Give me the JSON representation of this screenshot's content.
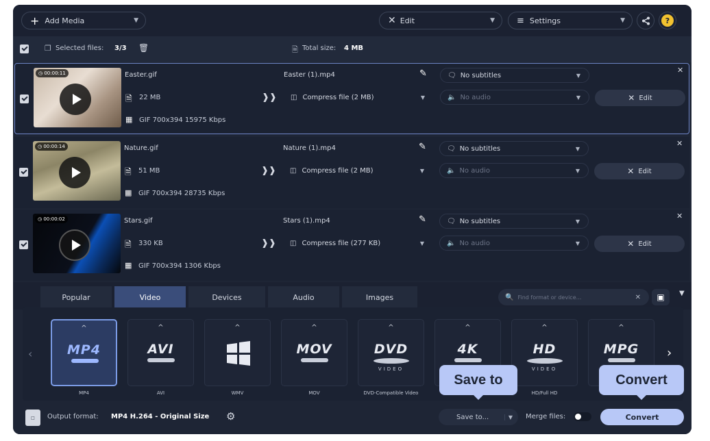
{
  "toolbar": {
    "add_media": "Add Media",
    "edit": "Edit",
    "settings": "Settings"
  },
  "selection": {
    "selected_label": "Selected files:",
    "selected_value": "3/3",
    "total_label": "Total size:",
    "total_value": "4 MB"
  },
  "files": [
    {
      "duration": "00:00:11",
      "name": "Easter.gif",
      "size": "22 MB",
      "info": "GIF 700x394 15975 Kbps",
      "output": "Easter (1).mp4",
      "compress": "Compress file (2 MB)",
      "subtitles": "No subtitles",
      "audio": "No audio",
      "edit": "Edit"
    },
    {
      "duration": "00:00:14",
      "name": "Nature.gif",
      "size": "51 MB",
      "info": "GIF 700x394 28735 Kbps",
      "output": "Nature (1).mp4",
      "compress": "Compress file (2 MB)",
      "subtitles": "No subtitles",
      "audio": "No audio",
      "edit": "Edit"
    },
    {
      "duration": "00:00:02",
      "name": "Stars.gif",
      "size": "330 KB",
      "info": "GIF 700x394 1306 Kbps",
      "output": "Stars (1).mp4",
      "compress": "Compress file (277 KB)",
      "subtitles": "No subtitles",
      "audio": "No audio",
      "edit": "Edit"
    }
  ],
  "tabs": [
    "Popular",
    "Video",
    "Devices",
    "Audio",
    "Images"
  ],
  "active_tab": "Video",
  "search_placeholder": "Find format or device...",
  "formats": [
    {
      "logo": "MP4",
      "caption": "MP4",
      "active": true
    },
    {
      "logo": "AVI",
      "caption": "AVI"
    },
    {
      "logo": "",
      "caption": "WMV"
    },
    {
      "logo": "MOV",
      "caption": "MOV"
    },
    {
      "logo": "DVD",
      "caption": "DVD-Compatible Video"
    },
    {
      "logo": "4K",
      "caption": ""
    },
    {
      "logo": "HD",
      "caption": "HD/Full HD"
    },
    {
      "logo": "MPG",
      "caption": ""
    }
  ],
  "format_sublabels": {
    "video": "VIDEO"
  },
  "bottom": {
    "output_label": "Output format:",
    "output_value": "MP4 H.264 - Original Size",
    "save_to": "Save to...",
    "merge_label": "Merge files:",
    "convert": "Convert"
  },
  "callouts": {
    "save_to": "Save to",
    "convert": "Convert"
  },
  "colors": {
    "accent": "#b8c8f7",
    "background": "#1e2535",
    "active_tab": "#3a4d7a"
  }
}
